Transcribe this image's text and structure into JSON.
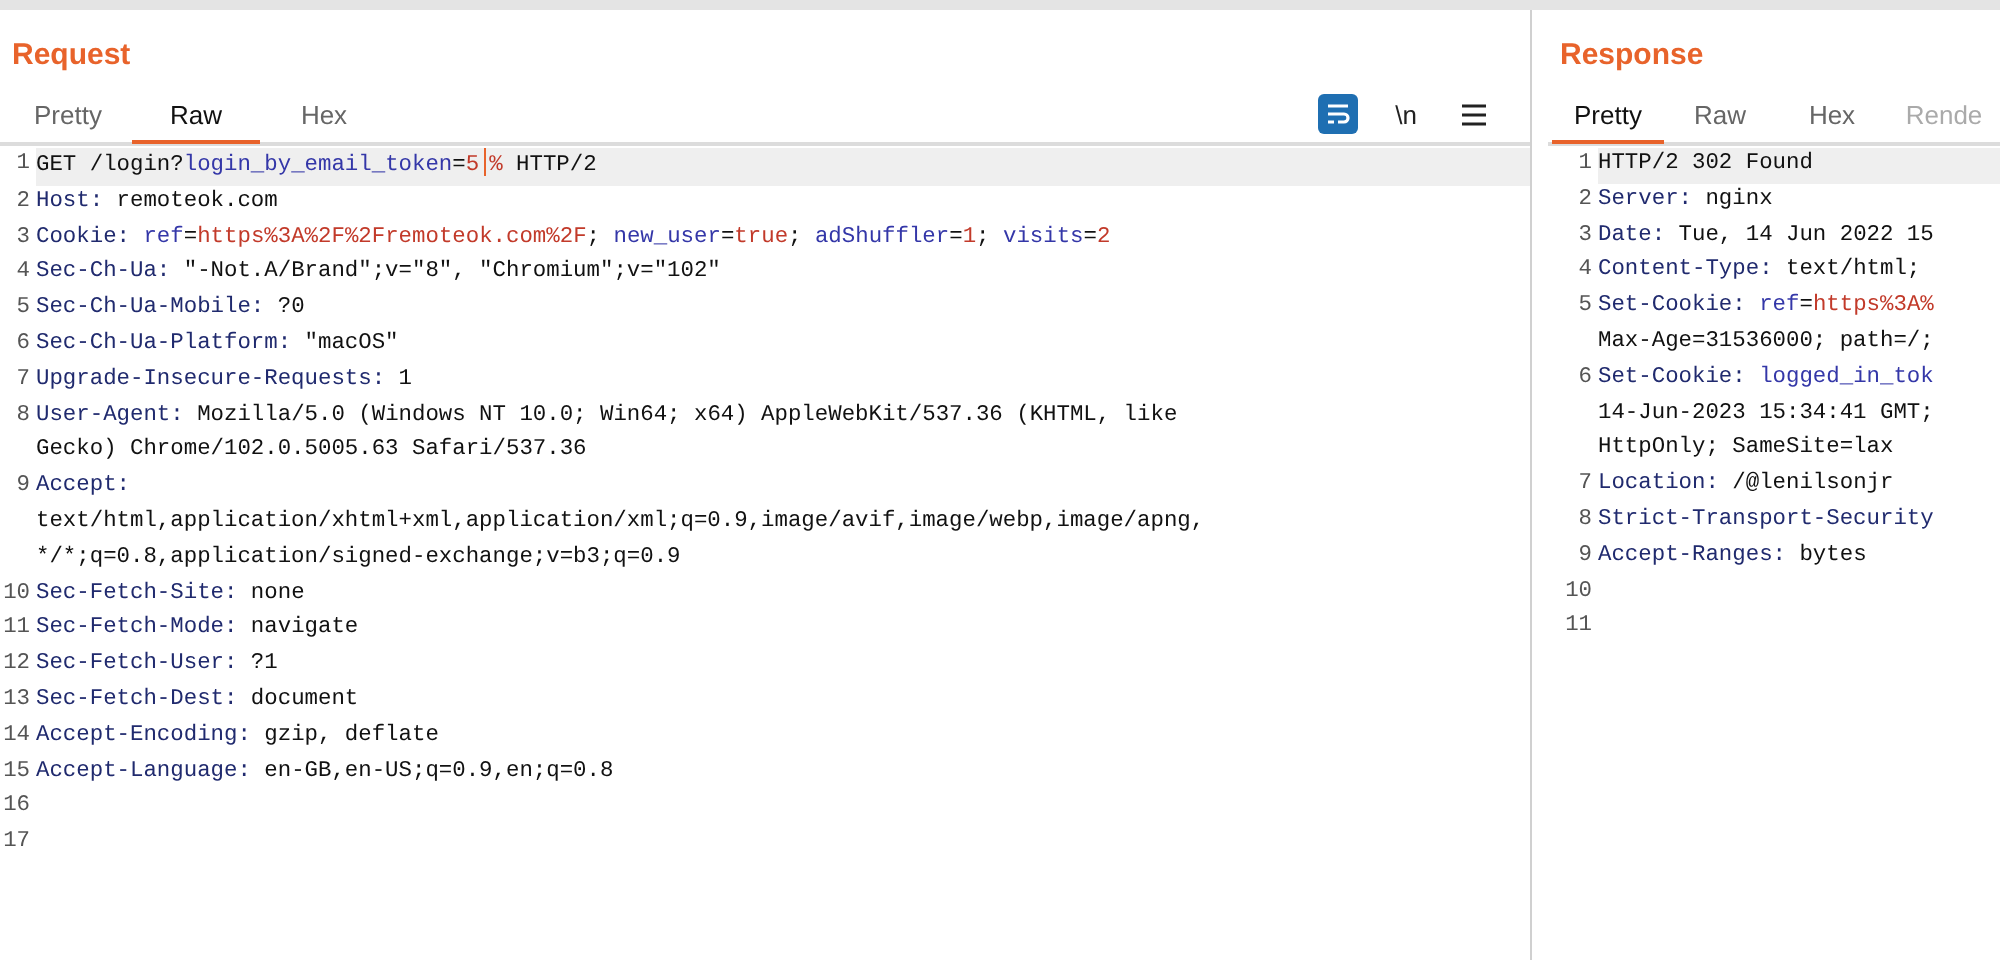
{
  "panels": [
    {
      "title": "Request",
      "tabs": [
        {
          "label": "Pretty",
          "selected": false,
          "disabled": false
        },
        {
          "label": "Raw",
          "selected": true,
          "disabled": false
        },
        {
          "label": "Hex",
          "selected": false,
          "disabled": false
        }
      ],
      "toolbar": [
        {
          "kind": "wrap",
          "on": true
        },
        {
          "kind": "text",
          "label": "\\n",
          "on": false
        },
        {
          "kind": "menu",
          "on": false
        }
      ],
      "lines": [
        {
          "number": "1",
          "current": true,
          "segments": [
            {
              "kind": "plain",
              "text": "GET /login?"
            },
            {
              "kind": "name",
              "text": "login_by_email_token"
            },
            {
              "kind": "plain",
              "text": "="
            },
            {
              "kind": "value",
              "text": "5"
            },
            {
              "kind": "caret"
            },
            {
              "kind": "value",
              "text": "%"
            },
            {
              "kind": "plain",
              "text": " HTTP/2"
            }
          ]
        },
        {
          "number": "2",
          "current": false,
          "segments": [
            {
              "kind": "key",
              "text": "Host:"
            },
            {
              "kind": "plain",
              "text": " remoteok.com"
            }
          ]
        },
        {
          "number": "3",
          "current": false,
          "segments": [
            {
              "kind": "key",
              "text": "Cookie: "
            },
            {
              "kind": "name",
              "text": "ref"
            },
            {
              "kind": "plain",
              "text": "="
            },
            {
              "kind": "value",
              "text": "https%3A%2F%2Fremoteok.com%2F"
            },
            {
              "kind": "plain",
              "text": "; "
            },
            {
              "kind": "name",
              "text": "new_user"
            },
            {
              "kind": "plain",
              "text": "="
            },
            {
              "kind": "value",
              "text": "true"
            },
            {
              "kind": "plain",
              "text": "; "
            },
            {
              "kind": "name",
              "text": "adShuffler"
            },
            {
              "kind": "plain",
              "text": "="
            },
            {
              "kind": "value",
              "text": "1"
            },
            {
              "kind": "plain",
              "text": "; "
            },
            {
              "kind": "name",
              "text": "visits"
            },
            {
              "kind": "plain",
              "text": "="
            },
            {
              "kind": "value",
              "text": "2"
            }
          ]
        },
        {
          "number": "4",
          "current": false,
          "segments": [
            {
              "kind": "key",
              "text": "Sec-Ch-Ua:"
            },
            {
              "kind": "plain",
              "text": " \"-Not.A/Brand\";v=\"8\", \"Chromium\";v=\"102\""
            }
          ]
        },
        {
          "number": "5",
          "current": false,
          "segments": [
            {
              "kind": "key",
              "text": "Sec-Ch-Ua-Mobile:"
            },
            {
              "kind": "plain",
              "text": " ?0"
            }
          ]
        },
        {
          "number": "6",
          "current": false,
          "segments": [
            {
              "kind": "key",
              "text": "Sec-Ch-Ua-Platform:"
            },
            {
              "kind": "plain",
              "text": " \"macOS\""
            }
          ]
        },
        {
          "number": "7",
          "current": false,
          "segments": [
            {
              "kind": "key",
              "text": "Upgrade-Insecure-Requests:"
            },
            {
              "kind": "plain",
              "text": " 1"
            }
          ]
        },
        {
          "number": "8",
          "current": false,
          "segments": [
            {
              "kind": "key",
              "text": "User-Agent:"
            },
            {
              "kind": "plain",
              "text": " Mozilla/5.0 (Windows NT 10.0; Win64; x64) AppleWebKit/537.36 (KHTML, like"
            },
            {
              "kind": "break"
            },
            {
              "kind": "plain",
              "text": "Gecko) Chrome/102.0.5005.63 Safari/537.36"
            }
          ]
        },
        {
          "number": "9",
          "current": false,
          "segments": [
            {
              "kind": "key",
              "text": "Accept:"
            },
            {
              "kind": "break"
            },
            {
              "kind": "plain",
              "text": "text/html,application/xhtml+xml,application/xml;q=0.9,image/avif,image/webp,image/apng,"
            },
            {
              "kind": "break"
            },
            {
              "kind": "plain",
              "text": "*/*;q=0.8,application/signed-exchange;v=b3;q=0.9"
            }
          ]
        },
        {
          "number": "10",
          "current": false,
          "segments": [
            {
              "kind": "key",
              "text": "Sec-Fetch-Site:"
            },
            {
              "kind": "plain",
              "text": " none"
            }
          ]
        },
        {
          "number": "11",
          "current": false,
          "segments": [
            {
              "kind": "key",
              "text": "Sec-Fetch-Mode:"
            },
            {
              "kind": "plain",
              "text": " navigate"
            }
          ]
        },
        {
          "number": "12",
          "current": false,
          "segments": [
            {
              "kind": "key",
              "text": "Sec-Fetch-User:"
            },
            {
              "kind": "plain",
              "text": " ?1"
            }
          ]
        },
        {
          "number": "13",
          "current": false,
          "segments": [
            {
              "kind": "key",
              "text": "Sec-Fetch-Dest:"
            },
            {
              "kind": "plain",
              "text": " document"
            }
          ]
        },
        {
          "number": "14",
          "current": false,
          "segments": [
            {
              "kind": "key",
              "text": "Accept-Encoding:"
            },
            {
              "kind": "plain",
              "text": " gzip, deflate"
            }
          ]
        },
        {
          "number": "15",
          "current": false,
          "segments": [
            {
              "kind": "key",
              "text": "Accept-Language:"
            },
            {
              "kind": "plain",
              "text": " en-GB,en-US;q=0.9,en;q=0.8"
            }
          ]
        },
        {
          "number": "16",
          "current": false
        },
        {
          "number": "17",
          "current": false
        }
      ]
    },
    {
      "title": "Response",
      "tabs": [
        {
          "label": "Pretty",
          "selected": true,
          "disabled": false
        },
        {
          "label": "Raw",
          "selected": false,
          "disabled": false
        },
        {
          "label": "Hex",
          "selected": false,
          "disabled": false
        },
        {
          "label": "Rende",
          "selected": false,
          "disabled": true
        }
      ],
      "lines": [
        {
          "number": "1",
          "current": true,
          "segments": [
            {
              "kind": "plain",
              "text": "HTTP/2 302 Found"
            }
          ]
        },
        {
          "number": "2",
          "current": false,
          "segments": [
            {
              "kind": "key",
              "text": "Server:"
            },
            {
              "kind": "plain",
              "text": " nginx"
            }
          ]
        },
        {
          "number": "3",
          "current": false,
          "segments": [
            {
              "kind": "key",
              "text": "Date:"
            },
            {
              "kind": "plain",
              "text": " Tue, 14 Jun 2022 15"
            }
          ]
        },
        {
          "number": "4",
          "current": false,
          "segments": [
            {
              "kind": "key",
              "text": "Content-Type:"
            },
            {
              "kind": "plain",
              "text": " text/html;"
            }
          ]
        },
        {
          "number": "5",
          "current": false,
          "segments": [
            {
              "kind": "key",
              "text": "Set-Cookie: "
            },
            {
              "kind": "name",
              "text": "ref"
            },
            {
              "kind": "plain",
              "text": "="
            },
            {
              "kind": "value",
              "text": "https%3A%"
            },
            {
              "kind": "break"
            },
            {
              "kind": "plain",
              "text": "Max-Age=31536000; path=/;"
            }
          ]
        },
        {
          "number": "6",
          "current": false,
          "segments": [
            {
              "kind": "key",
              "text": "Set-Cookie: "
            },
            {
              "kind": "name",
              "text": "logged_in_tok"
            },
            {
              "kind": "break"
            },
            {
              "kind": "plain",
              "text": "14-Jun-2023 15:34:41 GMT;"
            },
            {
              "kind": "break"
            },
            {
              "kind": "plain",
              "text": "HttpOnly; SameSite=lax"
            }
          ]
        },
        {
          "number": "7",
          "current": false,
          "segments": [
            {
              "kind": "key",
              "text": "Location:"
            },
            {
              "kind": "plain",
              "text": " /@lenilsonjr"
            }
          ]
        },
        {
          "number": "8",
          "current": false,
          "segments": [
            {
              "kind": "key",
              "text": "Strict-Transport-Security"
            }
          ]
        },
        {
          "number": "9",
          "current": false,
          "segments": [
            {
              "kind": "key",
              "text": "Accept-Ranges:"
            },
            {
              "kind": "plain",
              "text": " bytes"
            }
          ]
        },
        {
          "number": "10",
          "current": false
        },
        {
          "number": "11",
          "current": false
        }
      ]
    }
  ]
}
